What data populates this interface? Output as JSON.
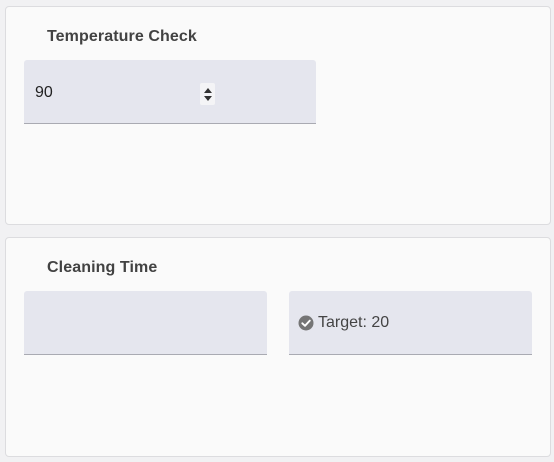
{
  "temperature": {
    "title": "Temperature Check",
    "value": "90"
  },
  "cleaning": {
    "title": "Cleaning Time",
    "input_value": "",
    "target_label": "Target: 20",
    "target_icon": "check-circle-icon"
  },
  "colors": {
    "field_bg": "#e5e6ee",
    "card_bg": "#fafafa",
    "icon": "#757575"
  }
}
